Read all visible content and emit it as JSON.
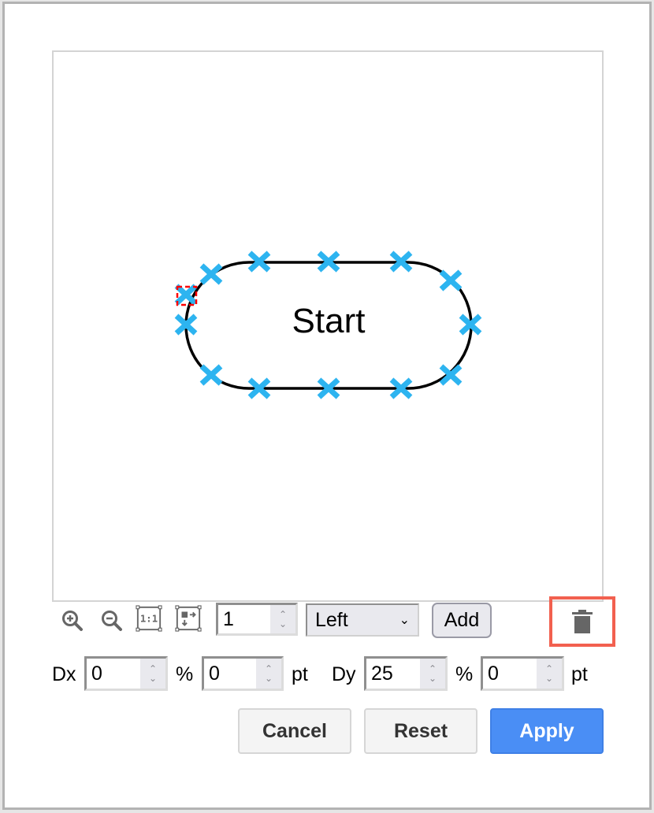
{
  "dialog": {
    "canvas": {
      "shape_label": "Start",
      "shape_type": "terminator",
      "connection_point_color": "#2db4f0",
      "selection_color": "#ff0000",
      "connection_point_count": 14
    },
    "toolbar": {
      "zoom_in_icon": "zoom-in-icon",
      "zoom_out_icon": "zoom-out-icon",
      "actual_size_icon": "actual-size-icon",
      "fit_icon": "fit-page-icon",
      "count_value": "1",
      "side_select": {
        "selected": "Left"
      },
      "add_label": "Add",
      "delete_icon": "trash-icon",
      "delete_highlight_color": "#f2604f"
    },
    "offsets": {
      "dx_label": "Dx",
      "dx_percent_value": "0",
      "percent_unit_1": "%",
      "dx_pt_value": "0",
      "pt_unit_1": "pt",
      "dy_label": "Dy",
      "dy_percent_value": "25",
      "percent_unit_2": "%",
      "dy_pt_value": "0",
      "pt_unit_2": "pt"
    },
    "buttons": {
      "cancel": "Cancel",
      "reset": "Reset",
      "apply": "Apply",
      "apply_color": "#4a8ef5"
    }
  }
}
